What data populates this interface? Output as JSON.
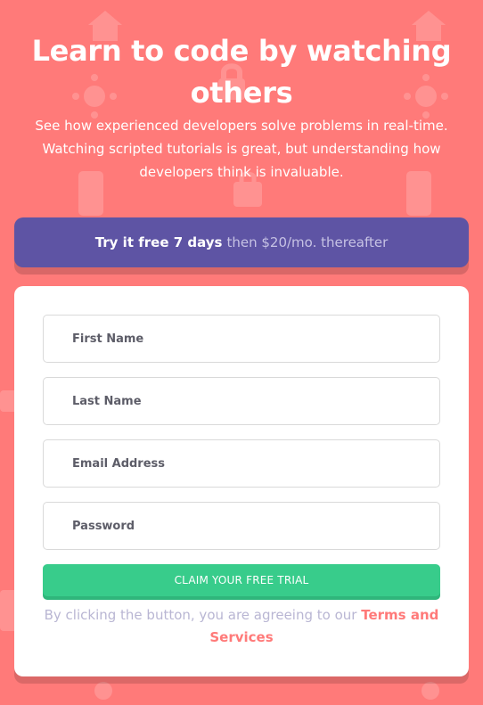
{
  "hero": {
    "title": "Learn to code by watching others",
    "description": "See how experienced developers solve problems in real-time. Watching scripted tutorials is great, but understanding how developers think is invaluable."
  },
  "offer": {
    "highlight": "Try it free 7 days",
    "details": "then $20/mo. thereafter"
  },
  "form": {
    "first_name_placeholder": "First Name",
    "last_name_placeholder": "Last Name",
    "email_placeholder": "Email Address",
    "password_placeholder": "Password",
    "submit_label": "CLAIM YOUR FREE TRIAL",
    "terms_prefix": "By clicking the button, you are agreeing to our",
    "terms_link": "Terms and Services"
  },
  "colors": {
    "background": "#ff7a79",
    "offer_bg": "#5e54a4",
    "button": "#38cc8b",
    "link": "#ff7a79"
  },
  "decorative_icons": [
    "house-icon",
    "virus-icon",
    "lock-icon",
    "phone-icon",
    "bag-icon"
  ]
}
